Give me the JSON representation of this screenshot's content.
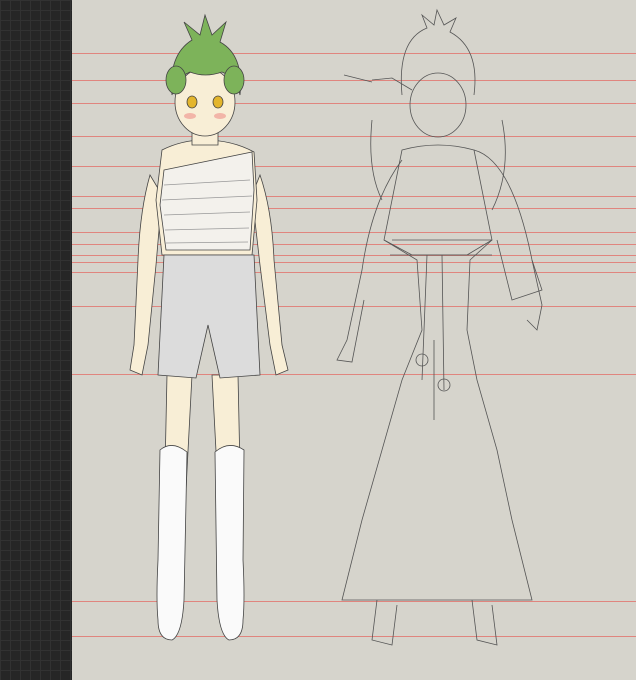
{
  "app": {
    "name": "",
    "document": "character-turnaround"
  },
  "canvas": {
    "background": "#d6d4cc",
    "guide_color": "#e0857e",
    "guide_count": 16
  },
  "left_panel": {
    "color": "#262626",
    "pattern": "grid"
  },
  "figures": [
    {
      "name": "base-model",
      "style": "colored",
      "hair_color": "#7db35a",
      "eye_color": "#e3b52d",
      "skin_color": "#f8eed6",
      "shorts_color": "#dcdcdc"
    },
    {
      "name": "outfit-lineart",
      "style": "lineart",
      "line_color": "#555555"
    }
  ]
}
